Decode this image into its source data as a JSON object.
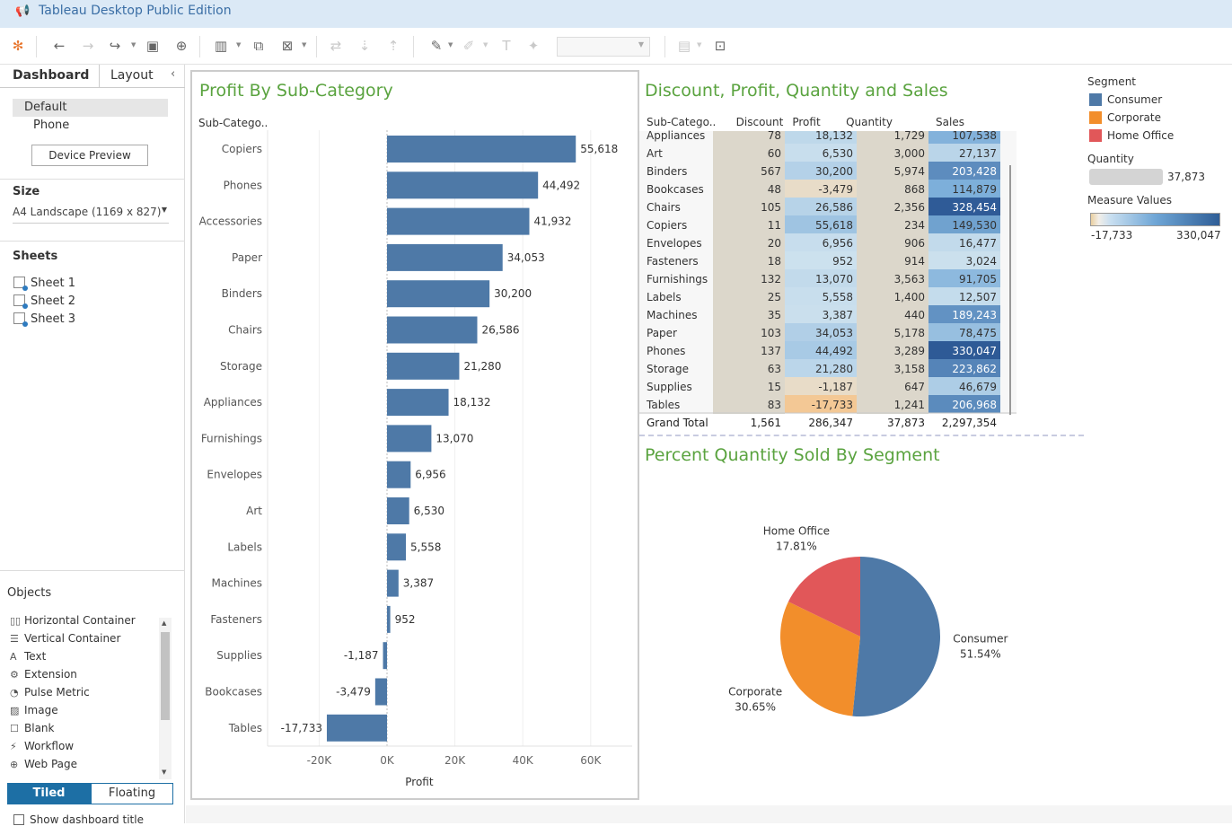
{
  "app": {
    "title": "Tableau Desktop Public Edition"
  },
  "left_panel": {
    "tabs": [
      "Dashboard",
      "Layout"
    ],
    "device_options": [
      "Default",
      "Phone"
    ],
    "device_preview_button": "Device Preview",
    "size_header": "Size",
    "size_value": "A4 Landscape (1169 x 827)",
    "sheets_header": "Sheets",
    "sheets": [
      "Sheet 1",
      "Sheet 2",
      "Sheet 3"
    ],
    "objects_header": "Objects",
    "objects": [
      {
        "icon": "horizontal-container-icon",
        "label": "Horizontal Container"
      },
      {
        "icon": "vertical-container-icon",
        "label": "Vertical Container"
      },
      {
        "icon": "text-icon",
        "label": "Text"
      },
      {
        "icon": "extension-icon",
        "label": "Extension"
      },
      {
        "icon": "pulse-metric-icon",
        "label": "Pulse Metric"
      },
      {
        "icon": "image-icon",
        "label": "Image"
      },
      {
        "icon": "blank-icon",
        "label": "Blank"
      },
      {
        "icon": "workflow-icon",
        "label": "Workflow"
      },
      {
        "icon": "web-page-icon",
        "label": "Web Page"
      }
    ],
    "layout_modes": [
      "Tiled",
      "Floating"
    ],
    "show_title_label": "Show dashboard title"
  },
  "colors": {
    "accent": "#1d6fa5",
    "bar": "#4e79a7",
    "title_green": "#5aa33f",
    "consumer": "#4e79a7",
    "corporate": "#f28e2b",
    "home_office": "#e15759"
  },
  "chart_data": [
    {
      "type": "bar",
      "title": "Profit By Sub-Category",
      "row_header": "Sub-Catego..",
      "xlabel": "Profit",
      "categories": [
        "Copiers",
        "Phones",
        "Accessories",
        "Paper",
        "Binders",
        "Chairs",
        "Storage",
        "Appliances",
        "Furnishings",
        "Envelopes",
        "Art",
        "Labels",
        "Machines",
        "Fasteners",
        "Supplies",
        "Bookcases",
        "Tables"
      ],
      "values": [
        55618,
        44492,
        41932,
        34053,
        30200,
        26586,
        21280,
        18132,
        13070,
        6956,
        6530,
        5558,
        3387,
        952,
        -1187,
        -3479,
        -17733
      ],
      "value_labels": [
        "55,618",
        "44,492",
        "41,932",
        "34,053",
        "30,200",
        "26,586",
        "21,280",
        "18,132",
        "13,070",
        "6,956",
        "6,530",
        "5,558",
        "3,387",
        "952",
        "-1,187",
        "-3,479",
        "-17,733"
      ],
      "xlim": [
        -30000,
        72000
      ],
      "xticks": [
        -20000,
        0,
        20000,
        40000,
        60000
      ],
      "xtick_labels": [
        "-20K",
        "0K",
        "20K",
        "40K",
        "60K"
      ]
    },
    {
      "type": "table",
      "title": "Discount, Profit, Quantity and Sales",
      "columns": [
        "Sub-Catego..",
        "Discount",
        "Profit",
        "Quantity",
        "Sales"
      ],
      "rows": [
        {
          "name": "Appliances",
          "discount": "78",
          "profit": "18,132",
          "quantity": "1,729",
          "sales": "107,538",
          "p": 18132,
          "s": 107538
        },
        {
          "name": "Art",
          "discount": "60",
          "profit": "6,530",
          "quantity": "3,000",
          "sales": "27,137",
          "p": 6530,
          "s": 27137
        },
        {
          "name": "Binders",
          "discount": "567",
          "profit": "30,200",
          "quantity": "5,974",
          "sales": "203,428",
          "p": 30200,
          "s": 203428
        },
        {
          "name": "Bookcases",
          "discount": "48",
          "profit": "-3,479",
          "quantity": "868",
          "sales": "114,879",
          "p": -3479,
          "s": 114879
        },
        {
          "name": "Chairs",
          "discount": "105",
          "profit": "26,586",
          "quantity": "2,356",
          "sales": "328,454",
          "p": 26586,
          "s": 328454
        },
        {
          "name": "Copiers",
          "discount": "11",
          "profit": "55,618",
          "quantity": "234",
          "sales": "149,530",
          "p": 55618,
          "s": 149530
        },
        {
          "name": "Envelopes",
          "discount": "20",
          "profit": "6,956",
          "quantity": "906",
          "sales": "16,477",
          "p": 6956,
          "s": 16477
        },
        {
          "name": "Fasteners",
          "discount": "18",
          "profit": "952",
          "quantity": "914",
          "sales": "3,024",
          "p": 952,
          "s": 3024
        },
        {
          "name": "Furnishings",
          "discount": "132",
          "profit": "13,070",
          "quantity": "3,563",
          "sales": "91,705",
          "p": 13070,
          "s": 91705
        },
        {
          "name": "Labels",
          "discount": "25",
          "profit": "5,558",
          "quantity": "1,400",
          "sales": "12,507",
          "p": 5558,
          "s": 12507
        },
        {
          "name": "Machines",
          "discount": "35",
          "profit": "3,387",
          "quantity": "440",
          "sales": "189,243",
          "p": 3387,
          "s": 189243
        },
        {
          "name": "Paper",
          "discount": "103",
          "profit": "34,053",
          "quantity": "5,178",
          "sales": "78,475",
          "p": 34053,
          "s": 78475
        },
        {
          "name": "Phones",
          "discount": "137",
          "profit": "44,492",
          "quantity": "3,289",
          "sales": "330,047",
          "p": 44492,
          "s": 330047
        },
        {
          "name": "Storage",
          "discount": "63",
          "profit": "21,280",
          "quantity": "3,158",
          "sales": "223,862",
          "p": 21280,
          "s": 223862
        },
        {
          "name": "Supplies",
          "discount": "15",
          "profit": "-1,187",
          "quantity": "647",
          "sales": "46,679",
          "p": -1187,
          "s": 46679
        },
        {
          "name": "Tables",
          "discount": "83",
          "profit": "-17,733",
          "quantity": "1,241",
          "sales": "206,968",
          "p": -17733,
          "s": 206968
        }
      ],
      "grand_total": {
        "name": "Grand Total",
        "discount": "1,561",
        "profit": "286,347",
        "quantity": "37,873",
        "sales": "2,297,354"
      }
    },
    {
      "type": "pie",
      "title": "Percent Quantity Sold By Segment",
      "slices": [
        {
          "name": "Consumer",
          "pct": 51.54,
          "label": "51.54%"
        },
        {
          "name": "Corporate",
          "pct": 30.65,
          "label": "30.65%"
        },
        {
          "name": "Home Office",
          "pct": 17.81,
          "label": "17.81%"
        }
      ]
    }
  ],
  "legend": {
    "segment_title": "Segment",
    "segments": [
      "Consumer",
      "Corporate",
      "Home Office"
    ],
    "quantity_title": "Quantity",
    "quantity_value": "37,873",
    "measure_title": "Measure Values",
    "measure_min": "-17,733",
    "measure_max": "330,047"
  }
}
